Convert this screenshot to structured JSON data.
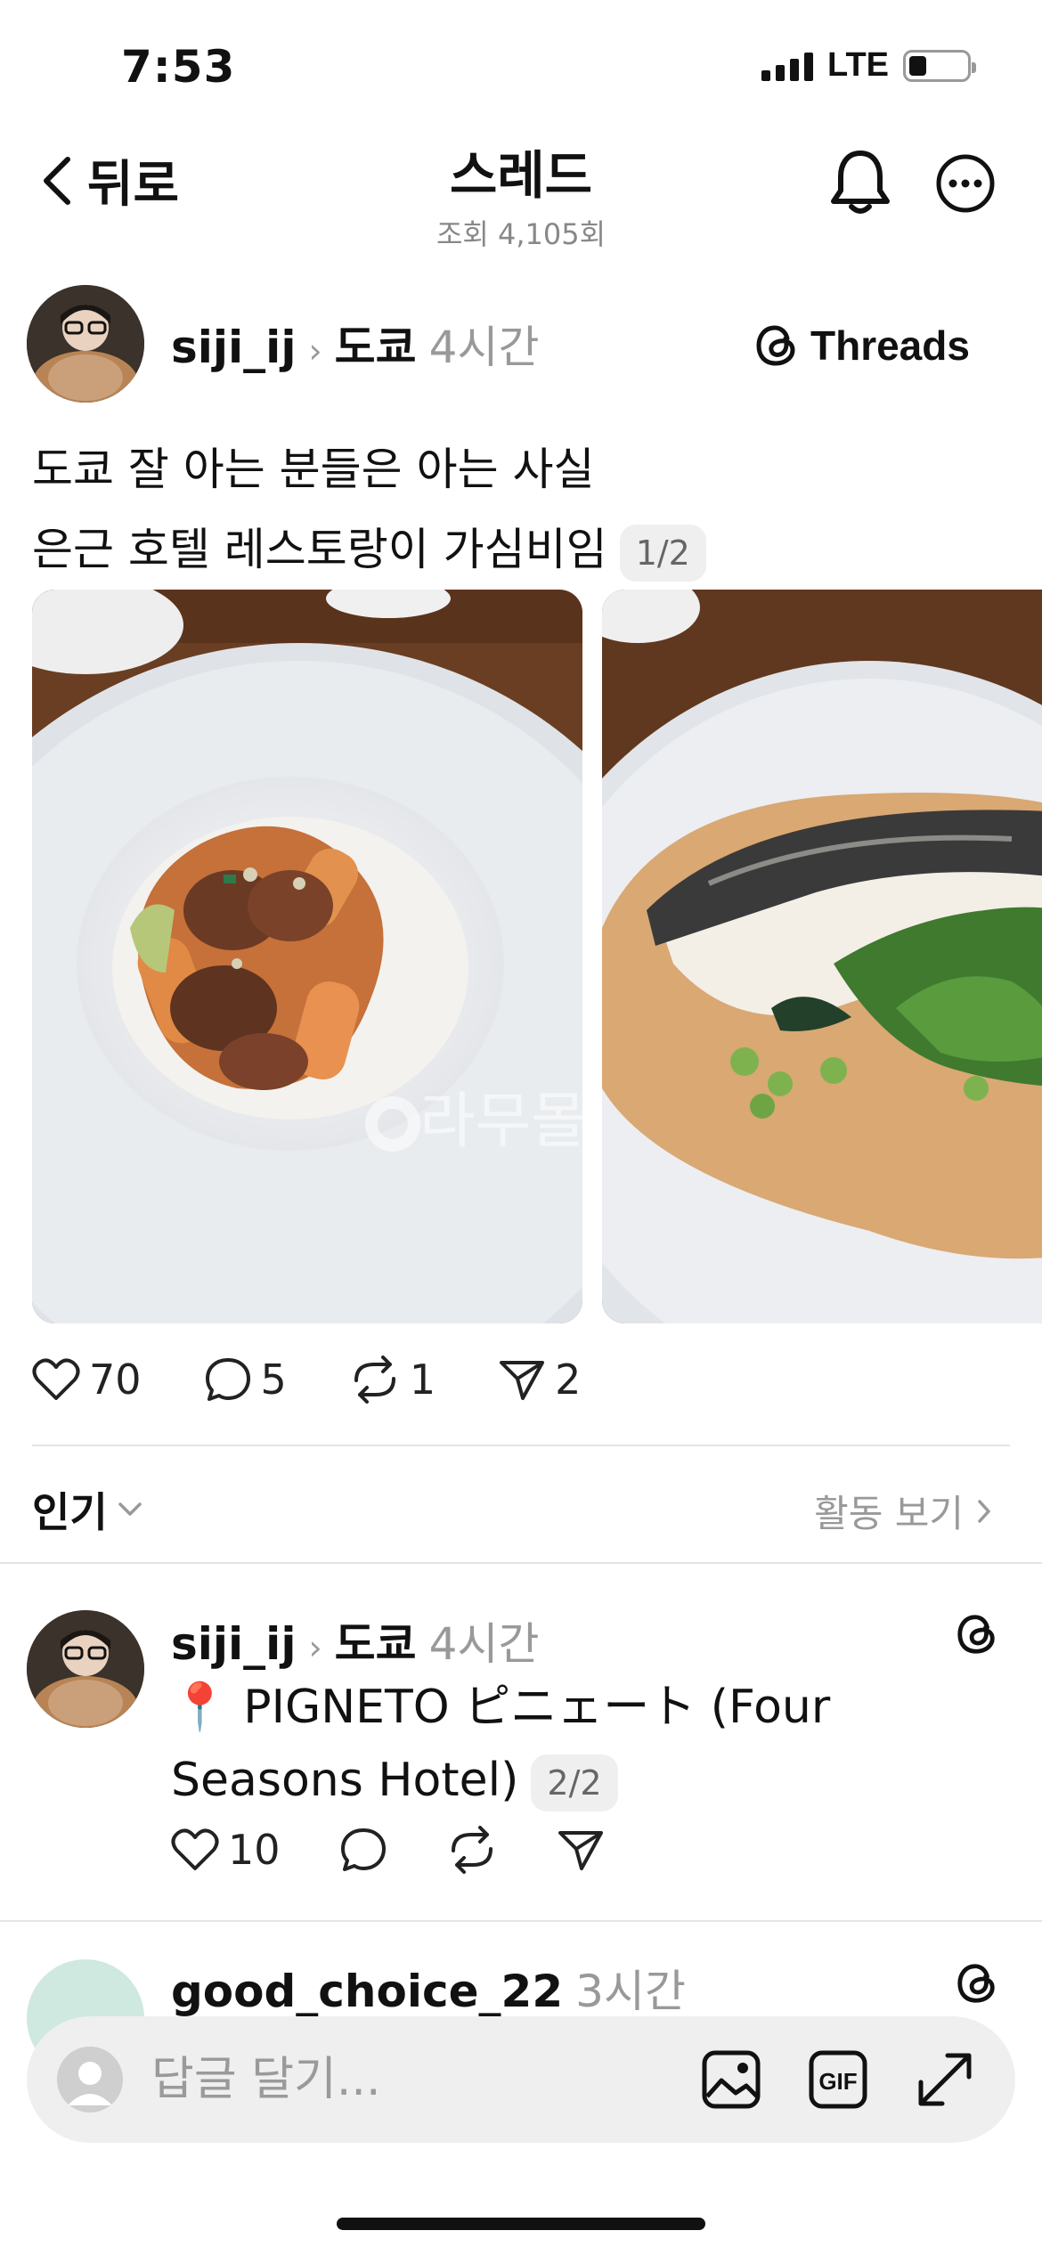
{
  "status_bar": {
    "time": "7:53",
    "network": "LTE",
    "battery_level": 0.3
  },
  "nav": {
    "back_label": "뒤로",
    "title": "스레드",
    "subtitle": "조회 4,105회"
  },
  "post": {
    "username": "siji_ij",
    "topic": "도쿄",
    "time": "4시간",
    "brand": "Threads",
    "text_line1": "도쿄 잘 아는 분들은 아는 사실",
    "text_line2": "은근 호텔 레스토랑이 가심비임",
    "page_badge": "1/2",
    "watermark": "라무몰",
    "likes": "70",
    "comments": "5",
    "reposts": "1",
    "shares": "2"
  },
  "sort": {
    "label": "인기",
    "activity_label": "활동 보기"
  },
  "reply": {
    "username": "siji_ij",
    "topic": "도쿄",
    "time": "4시간",
    "text_line1": "📍 PIGNETO ピニェート (Four",
    "text_line2": "Seasons Hotel)",
    "page_badge": "2/2",
    "likes": "10"
  },
  "reply2": {
    "username": "good_choice_22",
    "time": "3시간"
  },
  "compose": {
    "placeholder": "답글 달기..."
  }
}
